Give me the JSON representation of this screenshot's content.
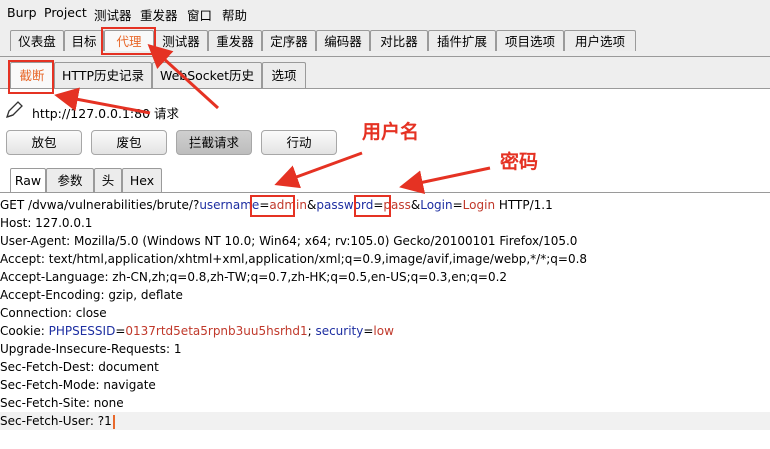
{
  "menu": [
    "Burp",
    "Project",
    "测试器",
    "重发器",
    "窗口",
    "帮助"
  ],
  "main_tabs": [
    "仪表盘",
    "目标",
    "代理",
    "测试器",
    "重发器",
    "定序器",
    "编码器",
    "对比器",
    "插件扩展",
    "项目选项",
    "用户选项"
  ],
  "proxy_tabs": [
    "截断",
    "HTTP历史记录",
    "WebSocket历史",
    "选项"
  ],
  "request_target": "http://127.0.0.1:80 请求",
  "actions": [
    "放包",
    "废包",
    "拦截请求",
    "行动"
  ],
  "view_tabs": [
    "Raw",
    "参数",
    "头",
    "Hex"
  ],
  "request": {
    "l1": {
      "a": "GET /dvwa/vulnerabilities/brute/?",
      "k1": "username",
      "eq1": "=",
      "v1": "admin",
      "amp1": "&",
      "k2": "password",
      "eq2": "=",
      "v2": "pass",
      "amp2": "&",
      "k3": "Login",
      "eq3": "=",
      "v3": "Login",
      "z": " HTTP/1.1"
    },
    "l2": "Host: 127.0.0.1",
    "l3": "User-Agent: Mozilla/5.0 (Windows NT 10.0; Win64; x64; rv:105.0) Gecko/20100101 Firefox/105.0",
    "l4": "Accept: text/html,application/xhtml+xml,application/xml;q=0.9,image/avif,image/webp,*/*;q=0.8",
    "l5": "Accept-Language: zh-CN,zh;q=0.8,zh-TW;q=0.7,zh-HK;q=0.5,en-US;q=0.3,en;q=0.2",
    "l6": "Accept-Encoding: gzip, deflate",
    "l7": "Connection: close",
    "l8": {
      "a": "Cookie: ",
      "k1": "PHPSESSID",
      "eq1": "=",
      "v1": "0137rtd5eta5rpnb3uu5hsrhd1",
      "sep": "; ",
      "k2": "security",
      "eq2": "=",
      "v2": "low"
    },
    "l9": "Upgrade-Insecure-Requests: 1",
    "l10": "Sec-Fetch-Dest: document",
    "l11": "Sec-Fetch-Mode: navigate",
    "l12": "Sec-Fetch-Site: none",
    "l13": "Sec-Fetch-User: ?1"
  },
  "annotations": {
    "username": "用户名",
    "password": "密码"
  },
  "colors": {
    "annotation": "#e53223",
    "param_key": "#1d2ea1",
    "param_value": "#c0392b",
    "active_tab": "#e8692c"
  }
}
